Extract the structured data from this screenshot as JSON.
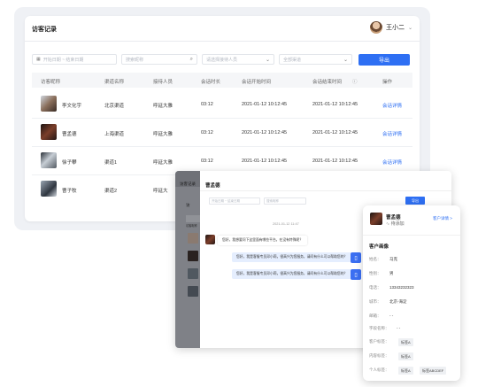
{
  "main": {
    "title": "访客记录",
    "user_name": "王小二",
    "filters": {
      "date_range_placeholder": "开始日期 ~ 结束日期",
      "search_placeholder": "搜索昵称",
      "agent_placeholder": "请选择接待人员",
      "channel_placeholder": "全部渠道",
      "export_label": "导出"
    },
    "columns": [
      "访客昵称",
      "渠道名称",
      "接待人员",
      "会话时长",
      "会话开始时间",
      "会话结束时间",
      "操作"
    ],
    "rows": [
      {
        "name": "李文化宇",
        "channel": "北京渠道",
        "agent": "呼延大雅",
        "duration": "03:12",
        "start": "2021-01-12 10:12:45",
        "end": "2021-01-12 10:12:45",
        "action": "会话详情"
      },
      {
        "name": "曹孟德",
        "channel": "上海渠道",
        "agent": "呼延大雅",
        "duration": "03:12",
        "start": "2021-01-12 10:12:45",
        "end": "2021-01-12 10:12:45",
        "action": "会话详情"
      },
      {
        "name": "徐子攀",
        "channel": "渠道1",
        "agent": "呼延大雅",
        "duration": "03:12",
        "start": "2021-01-12 10:12:45",
        "end": "2021-01-12 10:12:45",
        "action": "会话详情"
      },
      {
        "name": "曹子牧",
        "channel": "渠道2",
        "agent": "呼延大",
        "duration": "",
        "start": "",
        "end": "",
        "action": ""
      }
    ]
  },
  "chat": {
    "sidebar_title": "访客记录",
    "sidebar_sub": "访",
    "sidebar_item": "访客昵称",
    "header_name": "曹孟德",
    "date_placeholder": "开始日期 ~ 结束日期",
    "search_placeholder": "搜索昵称",
    "export_label": "导出",
    "timestamp": "2021-01-12 11:47",
    "visitor_msg": "您好，我想要问下这里面有哪些平台。在没有特殊呢？",
    "agent_msg_1": "您好，我是客服专员邓小莉，很高兴为您服务，请问有什么可以帮助您的？",
    "agent_msg_2": "您好，我是客服专员邓小莉，很高兴为您服务，请问有什么可以帮助您的？"
  },
  "panel": {
    "name": "曹孟德",
    "status": "待添加",
    "detail_link": "客户详情 >",
    "section": "客户画像",
    "fields": [
      {
        "label": "姓名：",
        "value": "马克"
      },
      {
        "label": "性别：",
        "value": "男"
      },
      {
        "label": "电话：",
        "value": "13343232323"
      },
      {
        "label": "城市：",
        "value": "北京-海淀"
      },
      {
        "label": "邮箱：",
        "value": "- -"
      },
      {
        "label": "字段名称：",
        "value": "- -"
      }
    ],
    "customer_tag_label": "客户标签：",
    "customer_tags": [
      "标签A"
    ],
    "content_tag_label": "内容标签：",
    "content_tags": [
      "标签A"
    ],
    "personal_tag_label": "个人标签：",
    "personal_tags": [
      "标签A",
      "标签ABCDEF"
    ]
  }
}
